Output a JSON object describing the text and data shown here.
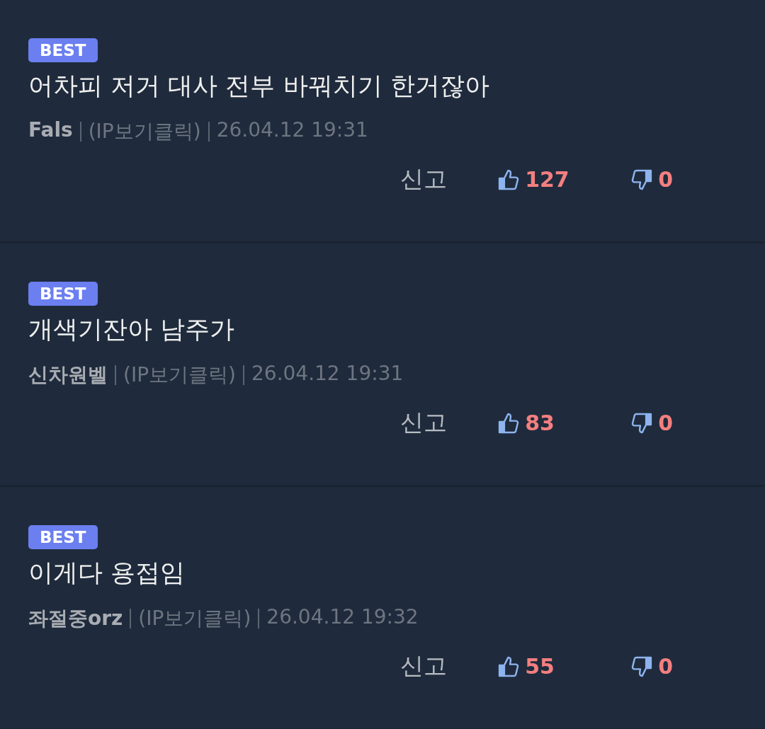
{
  "comments": [
    {
      "badge": "BEST",
      "text": "어차피 저거 대사 전부 바꿔치기 한거잖아",
      "author": "Fals",
      "ip": "(IP보기클릭)",
      "time": "26.04.12 19:31",
      "report": "신고",
      "likes": "127",
      "dislikes": "0"
    },
    {
      "badge": "BEST",
      "text": "개색기잔아 남주가",
      "author": "신차원벨",
      "ip": "(IP보기클릭)",
      "time": "26.04.12 19:31",
      "report": "신고",
      "likes": "83",
      "dislikes": "0"
    },
    {
      "badge": "BEST",
      "text": "이게다 용접임",
      "author": "좌절중orz",
      "ip": "(IP보기클릭)",
      "time": "26.04.12 19:32",
      "report": "신고",
      "likes": "55",
      "dislikes": "0"
    }
  ]
}
